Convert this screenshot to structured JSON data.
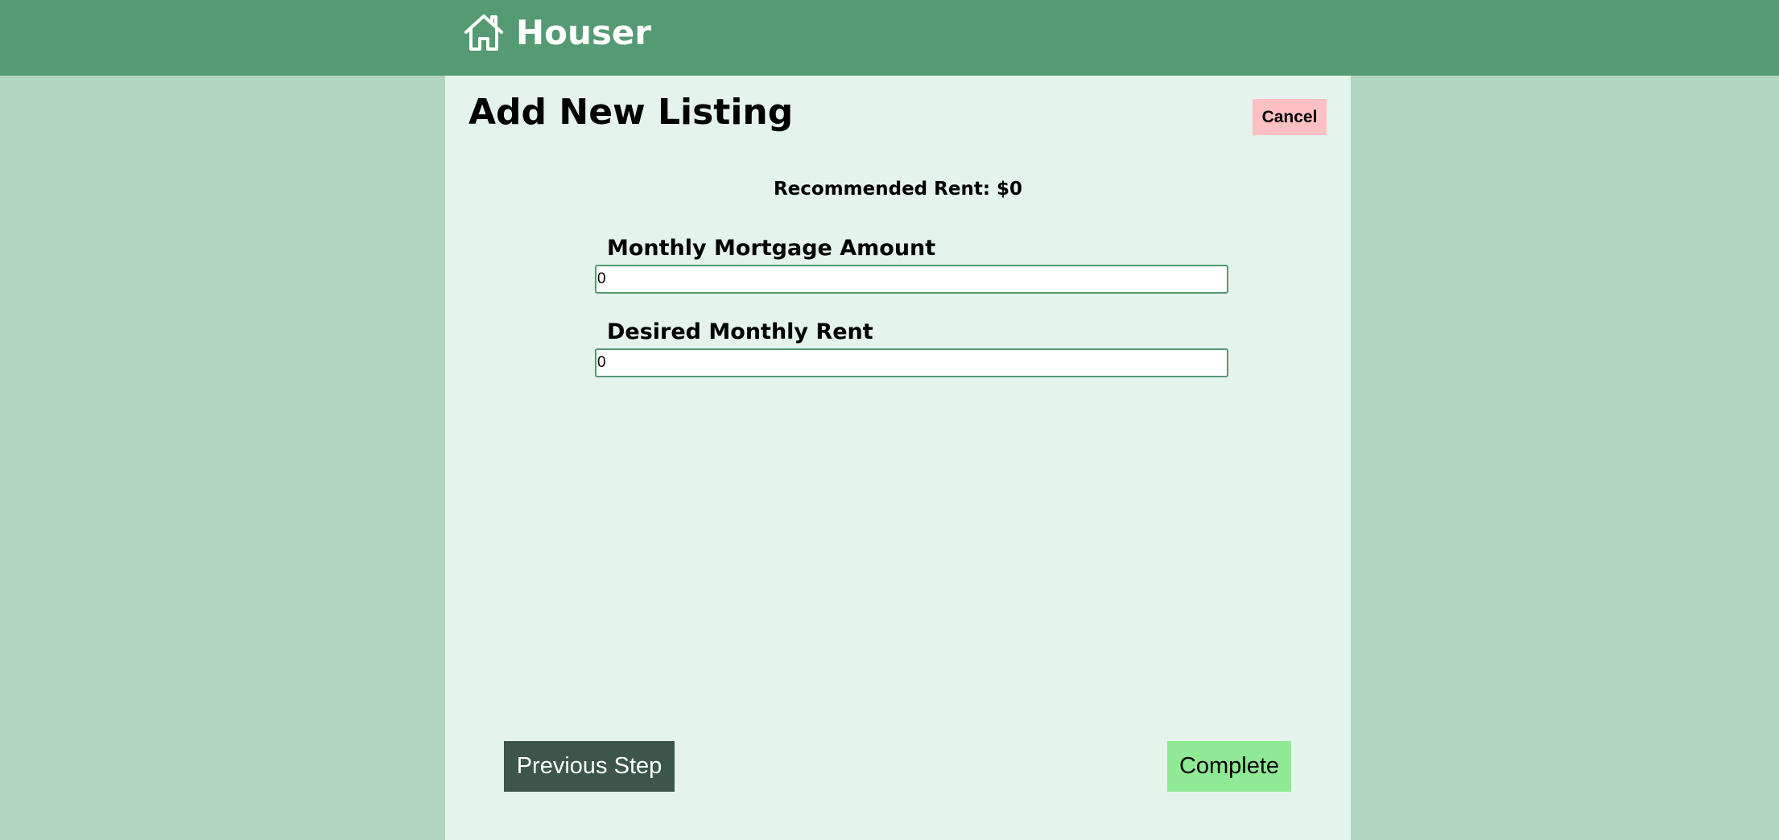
{
  "header": {
    "brand_name": "Houser",
    "brand_icon": "house-icon",
    "background_color": "#549a73"
  },
  "page": {
    "title": "Add New Listing",
    "cancel_label": "Cancel",
    "recommended_rent_text": "Recommended Rent: $0"
  },
  "form": {
    "fields": [
      {
        "label": "Monthly Mortgage Amount",
        "value": "0"
      },
      {
        "label": "Desired Monthly Rent",
        "value": "0"
      }
    ]
  },
  "footer": {
    "previous_label": "Previous Step",
    "complete_label": "Complete"
  },
  "colors": {
    "page_background": "#b0d5c0",
    "panel_background": "#e4f3eb",
    "cancel_button": "#ffc0c4",
    "previous_button": "#3c5649",
    "complete_button": "#90e994"
  }
}
